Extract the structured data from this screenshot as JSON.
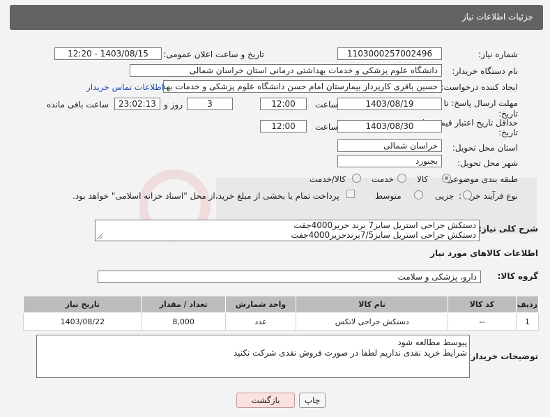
{
  "header": {
    "title": "جزئیات اطلاعات نیاز"
  },
  "fields": {
    "need_number_label": "شماره نیاز:",
    "need_number": "1103000257002496",
    "announce_label": "تاریخ و ساعت اعلان عمومی:",
    "announce_value": "1403/08/15 - 12:20",
    "buyer_label": "نام دستگاه خریدار:",
    "buyer_value": "دانشگاه علوم پزشکی و خدمات بهداشتی درمانی استان خراسان شمالی",
    "creator_label": "ایجاد کننده درخواست:",
    "creator_value": "حسین باقری کارپرداز بیمارستان امام حسن دانشگاه علوم پزشکی و خدمات بهد",
    "contact_link": "اطلاعات تماس خریدار",
    "deadline_label": "مهلت ارسال پاسخ: تا",
    "deadline_label2": "تاریخ:",
    "deadline_date": "1403/08/19",
    "time_label": "ساعت",
    "deadline_time": "12:00",
    "days_value": "3",
    "days_label": "روز و",
    "remaining_time": "23:02:13",
    "remaining_label": "ساعت باقی مانده",
    "validity_label": "حداقل تاریخ اعتبار قیمت: تا",
    "validity_label2": "تاریخ:",
    "validity_date": "1403/08/30",
    "validity_time": "12:00",
    "province_label": "استان محل تحویل:",
    "province_value": "خراسان شمالی",
    "city_label": "شهر محل تحویل:",
    "city_value": "بجنورد",
    "category_label": "طبقه بندی موضوعی:",
    "category_options": [
      "کالا",
      "خدمت",
      "کالا/خدمت"
    ],
    "process_label": "نوع فرآیند خرید :",
    "process_options": [
      "جزیی",
      "متوسط"
    ],
    "payment_note": "پرداخت تمام یا بخشی از مبلغ خرید،از محل \"اسناد خزانه اسلامی\" خواهد بود."
  },
  "description": {
    "label": "شرح کلی نیاز:",
    "line1": "دستکش جراحی استریل سایز7 برند حریر4000جفت",
    "line2": "دستکش جراحی استریل سایز7/5برندحریر4000جفت"
  },
  "goods_section": {
    "title": "اطلاعات کالاهای مورد نیاز",
    "group_label": "گروه کالا:",
    "group_value": "دارو، پزشکی و سلامت"
  },
  "table": {
    "headers": [
      "ردیف",
      "کد کالا",
      "نام کالا",
      "واحد شمارش",
      "تعداد / مقدار",
      "تاریخ نیاز"
    ],
    "rows": [
      [
        "1",
        "--",
        "دستکش جراحی لاتکس",
        "عدد",
        "8,000",
        "1403/08/22"
      ]
    ]
  },
  "buyer_notes": {
    "label": "توضیحات خریدار:",
    "line1": "پیوسط مطالعه شود",
    "line2": "شرایط خرید نقدی نداریم لطفا در صورت فروش نقدی شرکت نکنید"
  },
  "buttons": {
    "print": "چاپ",
    "back": "بازگشت"
  },
  "colors": {
    "header_bg": "#636363",
    "link": "#1e4bb3",
    "back_button": "#fbe1e1"
  }
}
